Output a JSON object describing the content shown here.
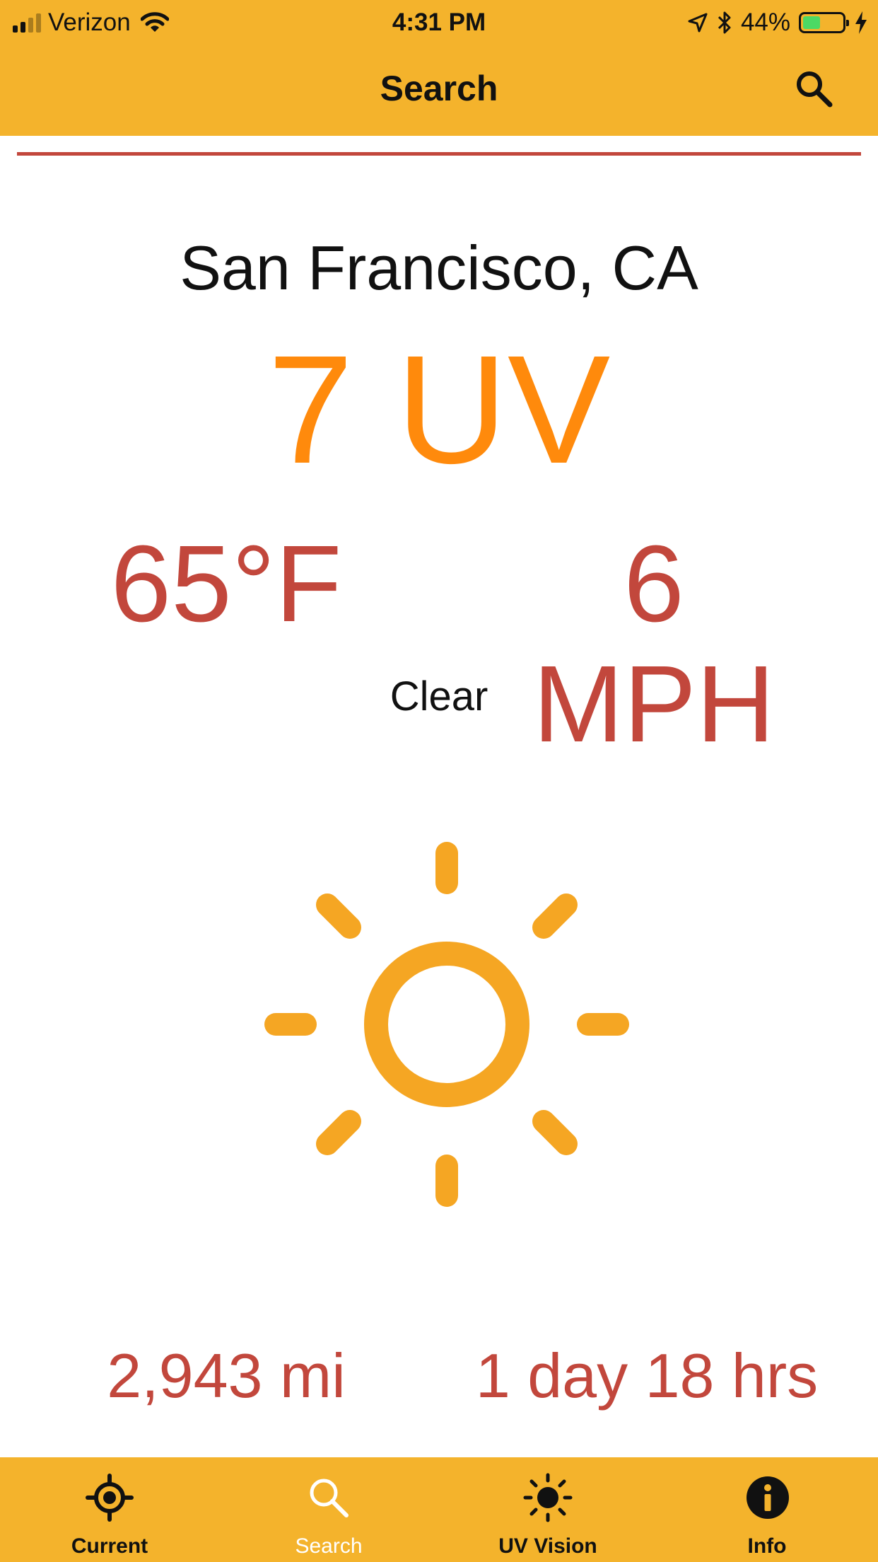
{
  "status_bar": {
    "carrier": "Verizon",
    "time": "4:31 PM",
    "battery_percent": "44%",
    "battery_level": 0.44,
    "signal_bars": 4,
    "signal_bars_filled": 2
  },
  "nav": {
    "title": "Search",
    "search_icon": "search-icon"
  },
  "weather": {
    "city": "San Francisco, CA",
    "uv": "7 UV",
    "temperature": "65°F",
    "wind": "6 MPH",
    "condition": "Clear",
    "condition_icon": "sun-icon",
    "distance": "2,943 mi",
    "duration": "1 day 18 hrs"
  },
  "tabs": [
    {
      "label": "Current",
      "icon": "location-target-icon",
      "active": false
    },
    {
      "label": "Search",
      "icon": "search-icon",
      "active": true
    },
    {
      "label": "UV Vision",
      "icon": "sun-icon",
      "active": false
    },
    {
      "label": "Info",
      "icon": "info-icon",
      "active": false
    }
  ],
  "colors": {
    "bar_background": "#f4b32c",
    "uv_orange": "#ff8a0c",
    "accent_red": "#c2473c",
    "sun_icon": "#f5a623",
    "active_tab": "#ffffff"
  }
}
